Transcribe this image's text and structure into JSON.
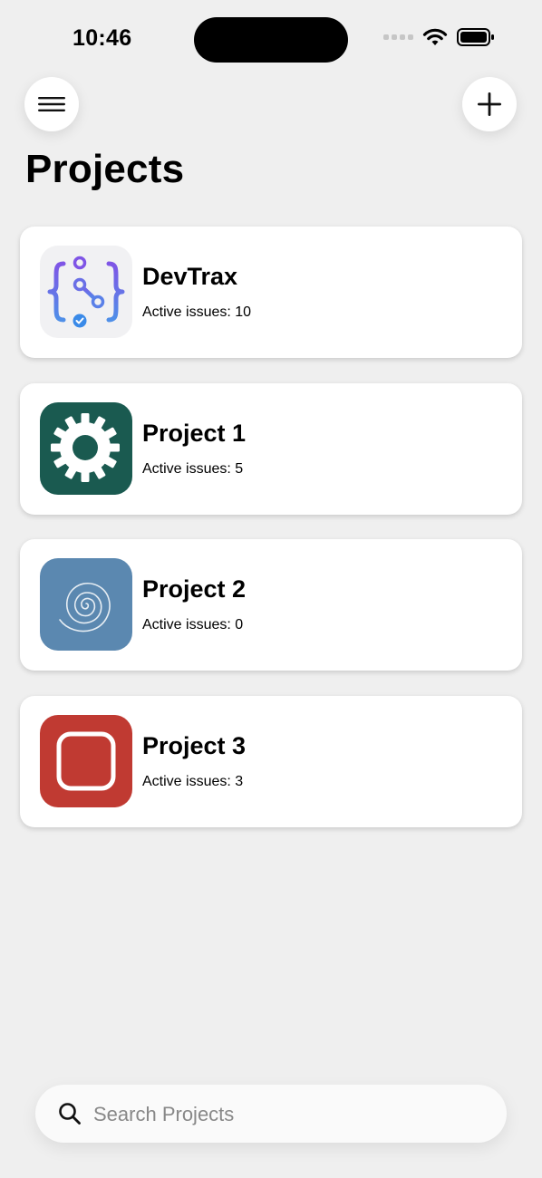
{
  "status_bar": {
    "time": "10:46"
  },
  "header": {
    "title": "Projects"
  },
  "projects": [
    {
      "name": "DevTrax",
      "issues": "Active issues: 10",
      "icon": "devtrax-logo-icon",
      "icon_bg": "#f1f1f3"
    },
    {
      "name": "Project 1",
      "issues": "Active issues: 5",
      "icon": "gear-icon",
      "icon_bg": "#1a5a50"
    },
    {
      "name": "Project 2",
      "issues": "Active issues: 0",
      "icon": "spiral-icon",
      "icon_bg": "#5b88b0"
    },
    {
      "name": "Project 3",
      "issues": "Active issues: 3",
      "icon": "rounded-square-icon",
      "icon_bg": "#c03a32"
    }
  ],
  "search": {
    "placeholder": "Search Projects"
  }
}
